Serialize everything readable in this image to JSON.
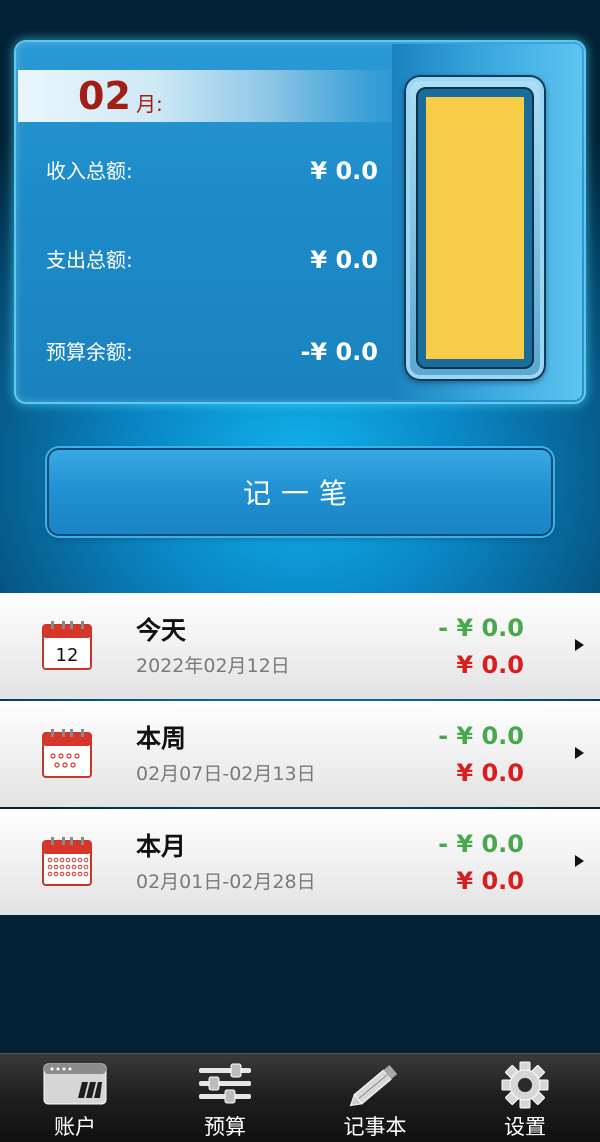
{
  "summary": {
    "month_number": "02",
    "month_suffix": "月:",
    "income_label": "收入总额:",
    "income_value": "¥ 0.0",
    "expense_label": "支出总额:",
    "expense_value": "¥ 0.0",
    "budget_label": "预算余额:",
    "budget_value": "-¥ 0.0",
    "meter_level_percent": 100,
    "meter_color": "#f7cd48"
  },
  "record_button": {
    "label": "记一笔"
  },
  "periods": [
    {
      "title": "今天",
      "range": "2022年02月12日",
      "income": "- ¥ 0.0",
      "expense": "¥ 0.0",
      "icon": "calendar-day-icon",
      "day": "12"
    },
    {
      "title": "本周",
      "range": "02月07日-02月13日",
      "income": "- ¥ 0.0",
      "expense": "¥ 0.0",
      "icon": "calendar-week-icon"
    },
    {
      "title": "本月",
      "range": "02月01日-02月28日",
      "income": "- ¥ 0.0",
      "expense": "¥ 0.0",
      "icon": "calendar-month-icon"
    }
  ],
  "nav": [
    {
      "label": "账户",
      "icon": "account-card-icon"
    },
    {
      "label": "预算",
      "icon": "sliders-icon"
    },
    {
      "label": "记事本",
      "icon": "pencil-icon"
    },
    {
      "label": "设置",
      "icon": "gear-icon"
    }
  ],
  "colors": {
    "income_green": "#49a84e",
    "expense_red": "#d81e1e",
    "month_red": "#a21d14",
    "calendar_red": "#d9362b"
  }
}
